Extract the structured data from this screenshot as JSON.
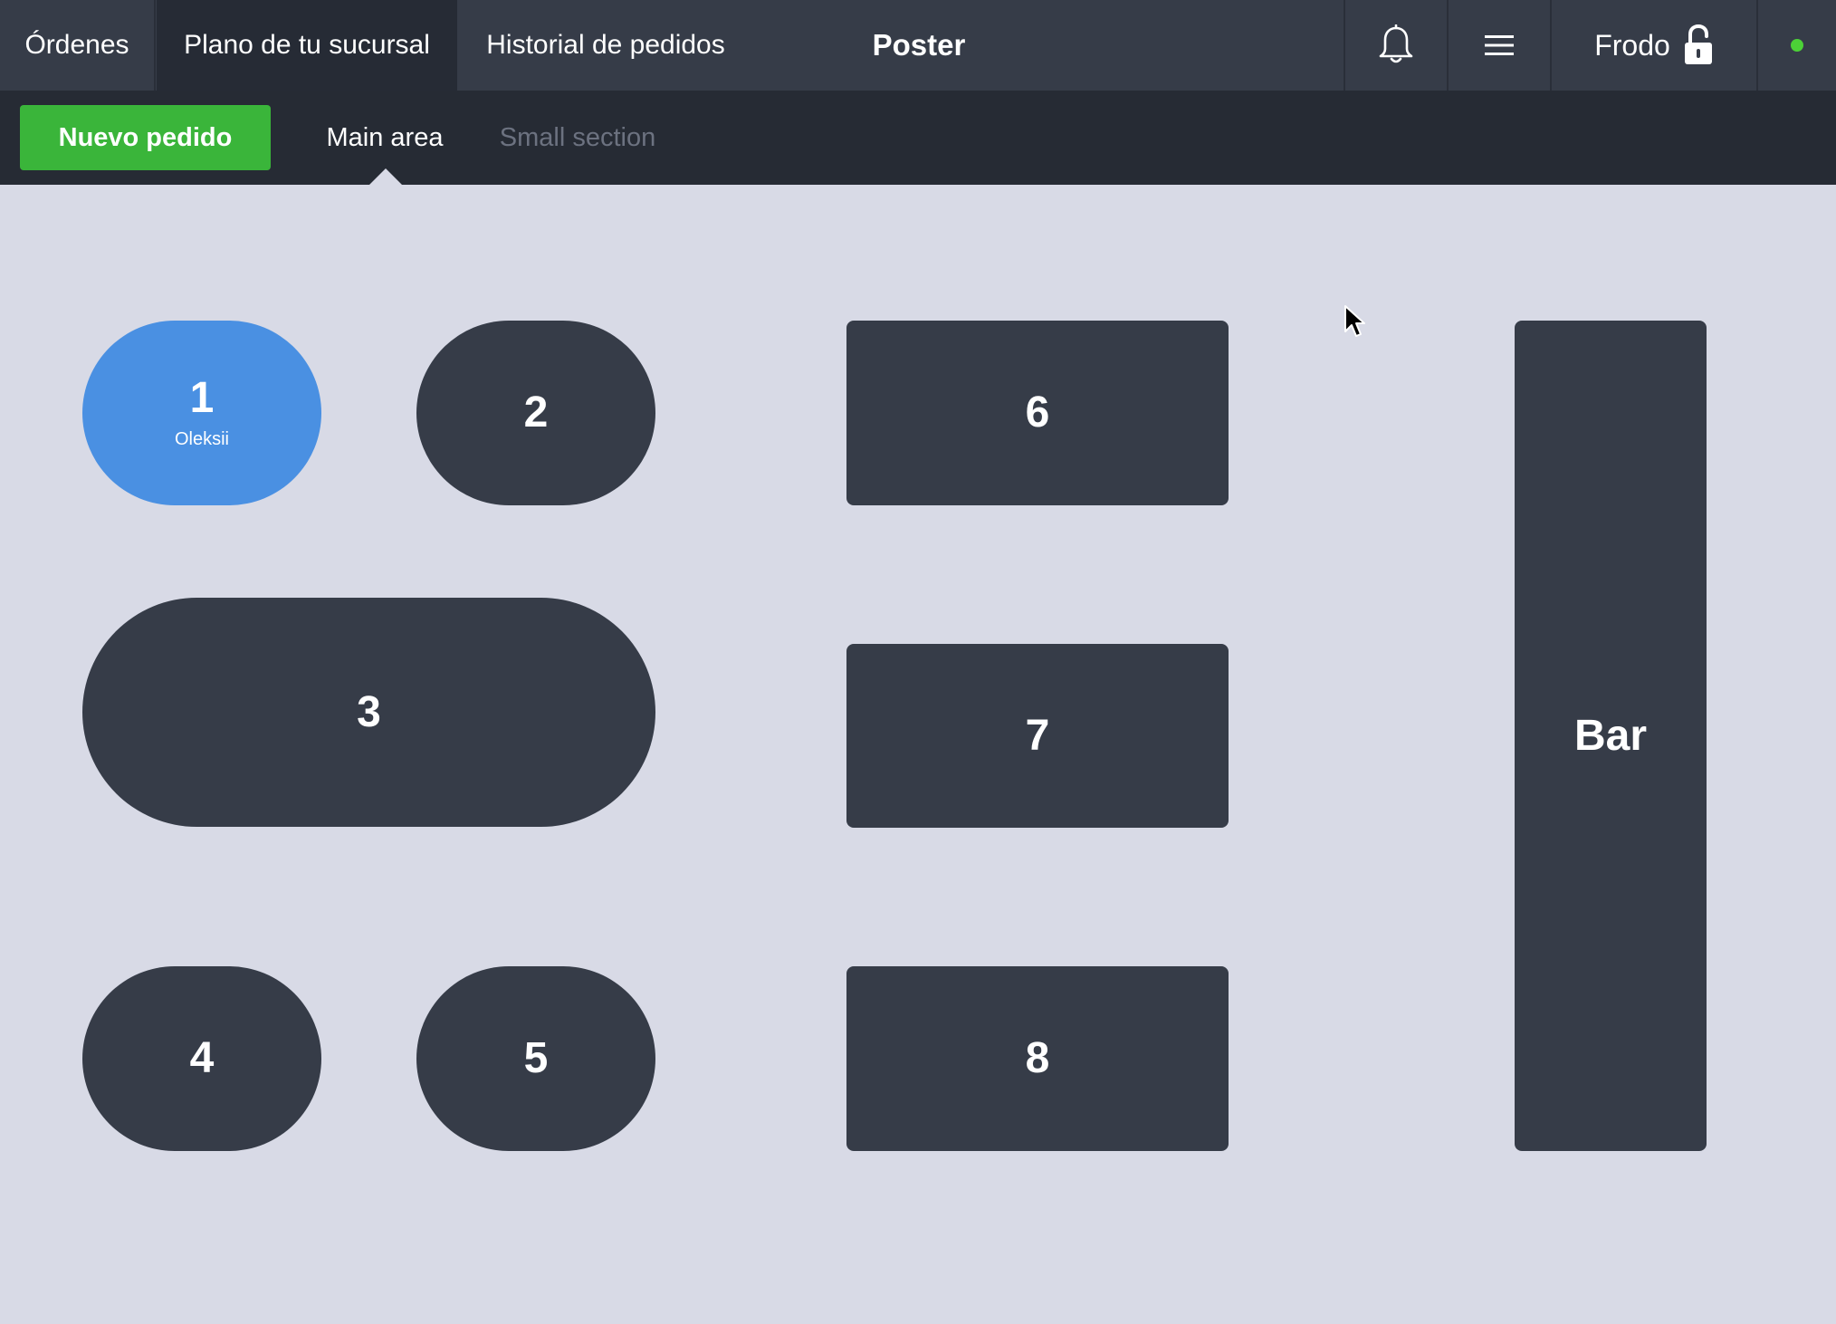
{
  "topbar": {
    "tabs": [
      {
        "label": "Órdenes"
      },
      {
        "label": "Plano de tu sucursal",
        "active": true
      },
      {
        "label": "Historial de pedidos"
      }
    ],
    "app_title": "Poster",
    "user_name": "Frodo",
    "icons": {
      "notifications": "bell-icon",
      "menu": "hamburger-menu-icon",
      "lock": "unlocked-padlock-icon",
      "status": "online-status-dot"
    },
    "status_color": "#4cd137"
  },
  "subbar": {
    "new_order_label": "Nuevo pedido",
    "new_order_color": "#3ab53a",
    "areas": [
      {
        "label": "Main area",
        "active": true
      },
      {
        "label": "Small section",
        "active": false
      }
    ]
  },
  "floor": {
    "tables": [
      {
        "label": "1",
        "shape": "oval",
        "guest": "Oleksii",
        "occupied": true
      },
      {
        "label": "2",
        "shape": "oval"
      },
      {
        "label": "3",
        "shape": "oval"
      },
      {
        "label": "4",
        "shape": "oval"
      },
      {
        "label": "5",
        "shape": "oval"
      },
      {
        "label": "6",
        "shape": "rect"
      },
      {
        "label": "7",
        "shape": "rect"
      },
      {
        "label": "8",
        "shape": "rect"
      },
      {
        "label": "Bar",
        "shape": "rect"
      }
    ],
    "colors": {
      "background": "#d8dae6",
      "table": "#363c48",
      "occupied": "#4a90e2"
    }
  }
}
